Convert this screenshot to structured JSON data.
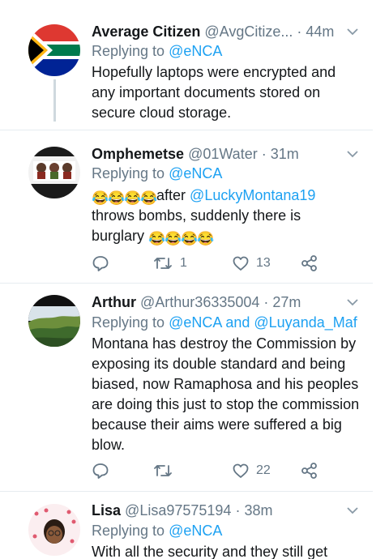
{
  "tweets": [
    {
      "name": "Average Citizen",
      "handle": "@AvgCitize...",
      "time": "· 44m",
      "replying_prefix": "Replying to ",
      "replying_to": "@eNCA",
      "text": "Hopefully laptops were encrypted and any important documents stored on secure cloud storage."
    },
    {
      "name": "Omphemetse",
      "handle": "@01Water",
      "time": "· 31m",
      "replying_prefix": "Replying to ",
      "replying_to": "@eNCA",
      "emoji": "😂",
      "text_after": "after",
      "mention": "@LuckyMontana19",
      "text_lines": [
        "throws bombs, suddenly there is",
        "burglary"
      ],
      "reply_count": "",
      "retweet_count": "1",
      "like_count": "13"
    },
    {
      "name": "Arthur",
      "handle": "@Arthur36335004",
      "time": "· 27m",
      "replying_prefix": "Replying to ",
      "replying_to": "@eNCA and @Luyanda_Maf",
      "text": "Montana has destroy the Commission by exposing its double standard and being biased, now Ramaphosa and his peoples are doing this just to stop the commission because their aims were suffered a big blow.",
      "reply_count": "",
      "retweet_count": "",
      "like_count": "22"
    },
    {
      "name": "Lisa",
      "handle": "@Lisa97575194",
      "time": "· 38m",
      "replying_prefix": "Replying to ",
      "replying_to": "@eNCA",
      "text": "With all the security and they still get"
    }
  ],
  "icons": {
    "reply": "reply-icon",
    "retweet": "retweet-icon",
    "like": "heart-icon",
    "share": "share-icon",
    "more": "chevron-down-icon"
  },
  "colors": {
    "text": "#14171a",
    "secondary": "#657786",
    "link": "#1da1f2",
    "divider": "#e6ecf0"
  }
}
